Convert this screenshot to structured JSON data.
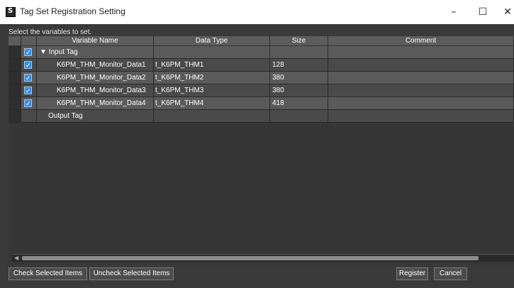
{
  "window": {
    "title": "Tag Set Registration Setting",
    "minimize": "–",
    "maximize": "☐",
    "close": "✕"
  },
  "hint": "Select the variables to set.",
  "columns": [
    "Variable Name",
    "Data Type",
    "Size",
    "Comment"
  ],
  "groups": {
    "input": "▼ Input Tag",
    "output": "Output Tag"
  },
  "rows": [
    {
      "checked": true,
      "name": "K6PM_THM_Monitor_Data1",
      "type": "t_K6PM_THM1",
      "size": "128",
      "comment": ""
    },
    {
      "checked": true,
      "name": "K6PM_THM_Monitor_Data2",
      "type": "t_K6PM_THM2",
      "size": "380",
      "comment": ""
    },
    {
      "checked": true,
      "name": "K6PM_THM_Monitor_Data3",
      "type": "t_K6PM_THM3",
      "size": "380",
      "comment": ""
    },
    {
      "checked": true,
      "name": "K6PM_THM_Monitor_Data4",
      "type": "t_K6PM_THM4",
      "size": "418",
      "comment": ""
    }
  ],
  "buttons": {
    "check": "Check Selected Items",
    "uncheck": "Uncheck Selected Items",
    "register": "Register",
    "cancel": "Cancel"
  }
}
